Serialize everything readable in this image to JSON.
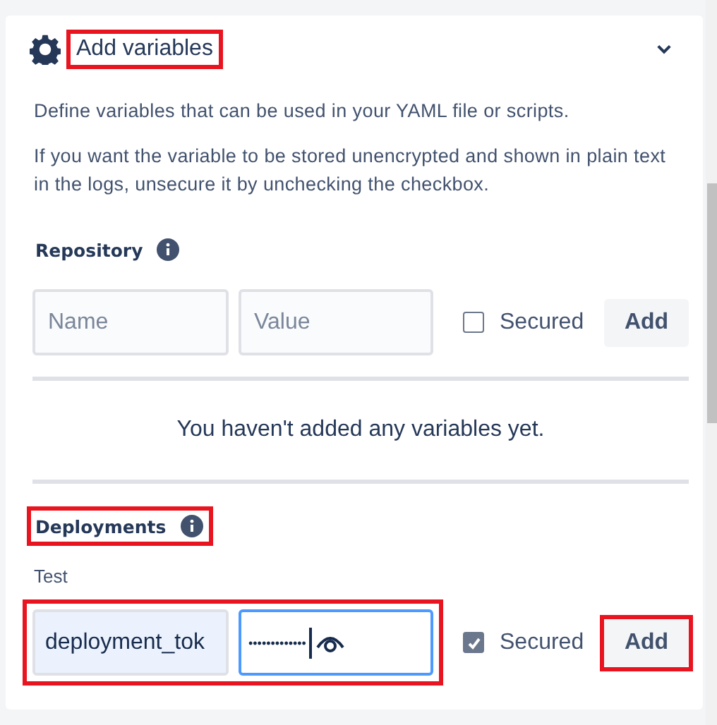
{
  "header": {
    "title": "Add variables",
    "highlighted": true,
    "expanded": true
  },
  "description": [
    "Define variables that can be used in your YAML file or scripts.",
    "If you want the variable to be stored unencrypted and shown in plain text in the logs, unsecure it by unchecking the checkbox."
  ],
  "repository": {
    "label": "Repository",
    "highlighted": false,
    "form": {
      "highlighted": false,
      "name": {
        "placeholder": "Name"
      },
      "value": {
        "placeholder": "Value",
        "focused": false
      },
      "secured": {
        "label": "Secured",
        "checked": false
      },
      "add_button": {
        "label": "Add",
        "highlighted": false
      }
    },
    "empty_message": "You haven't added any variables yet."
  },
  "deployments": {
    "label": "Deployments",
    "highlighted": true,
    "environment": "Test",
    "form": {
      "highlighted": true,
      "name": {
        "value": "deployment_tok"
      },
      "value": {
        "value": "•••••••••••••",
        "focused": true
      },
      "secured": {
        "label": "Secured",
        "checked": true
      },
      "add_button": {
        "label": "Add",
        "highlighted": true
      }
    }
  }
}
